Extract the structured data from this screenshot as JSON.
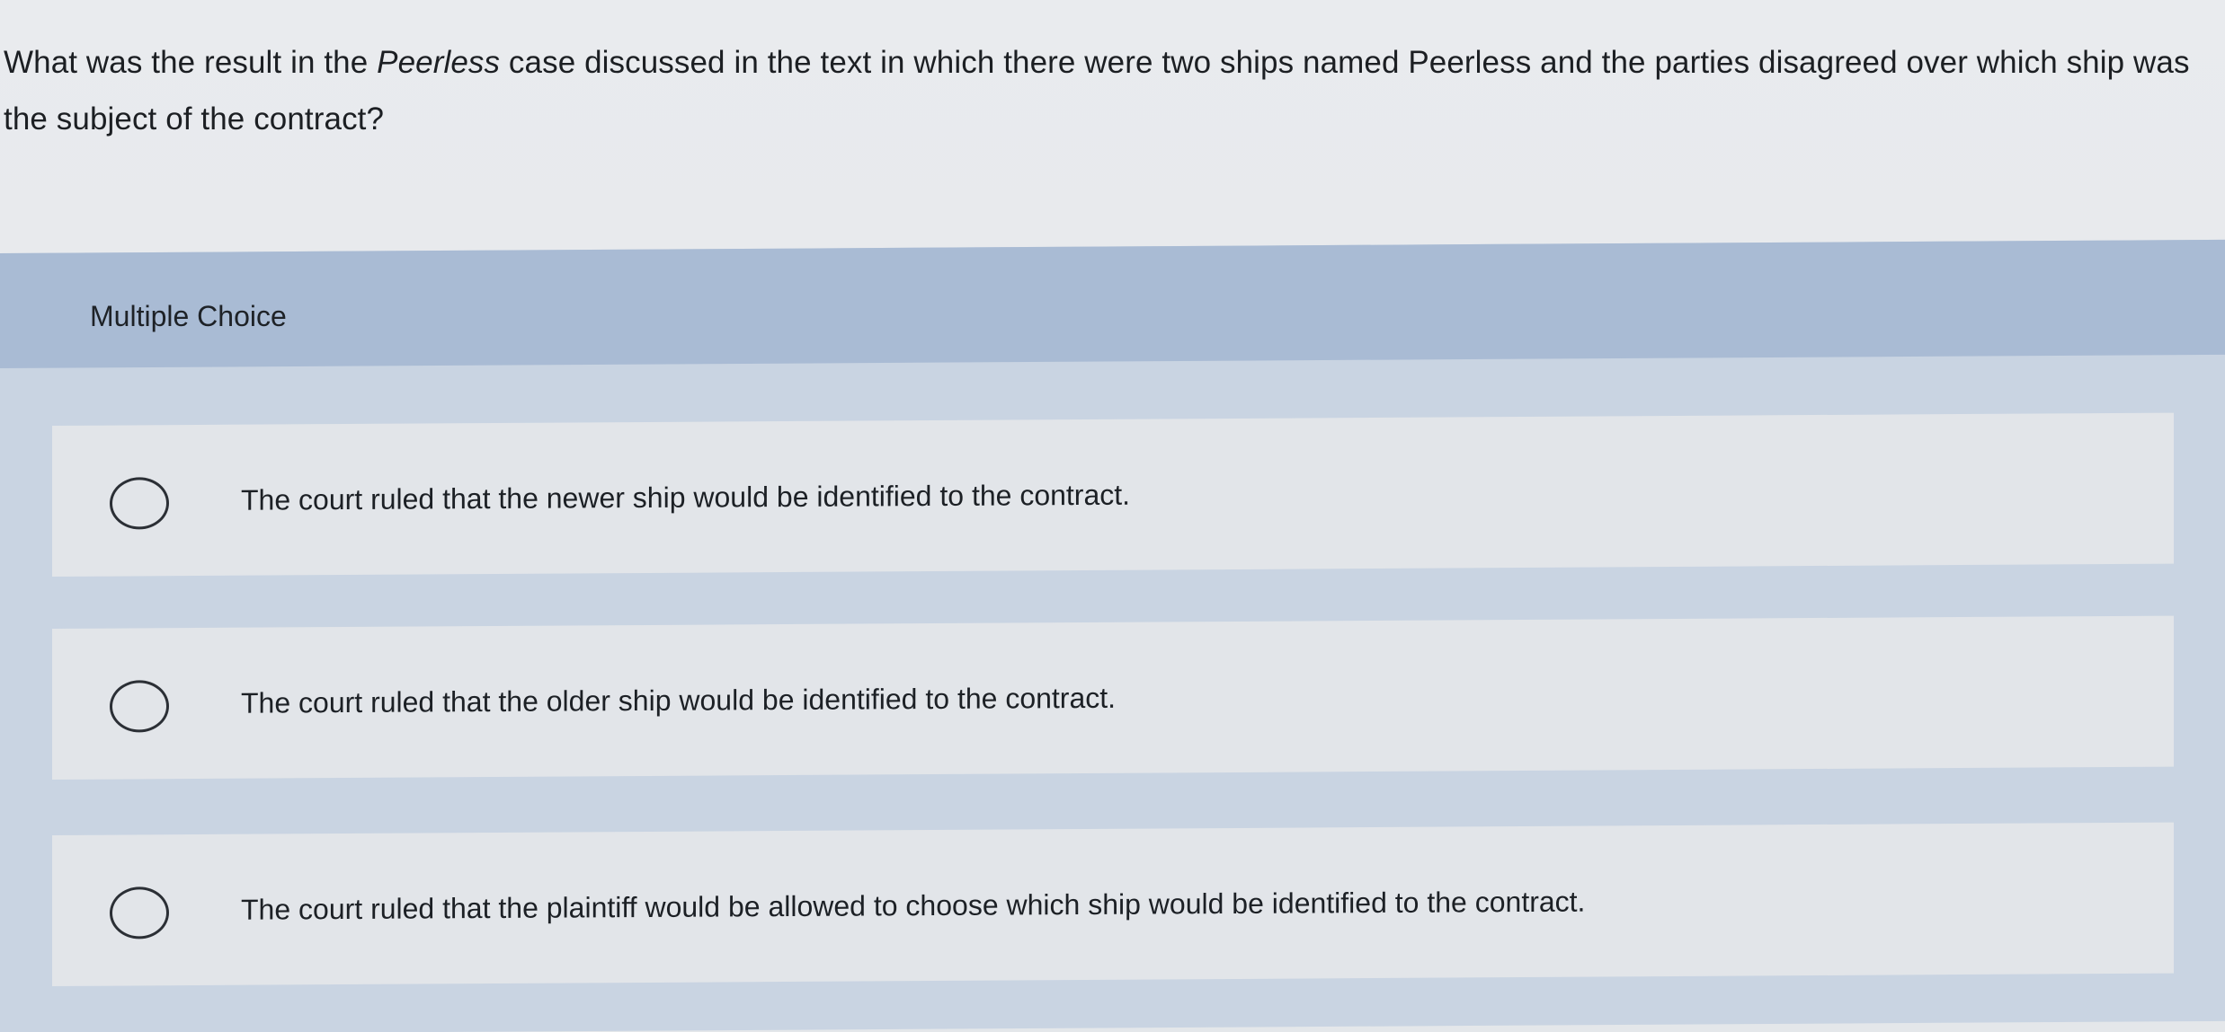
{
  "question": {
    "prefix": "What was the result in the ",
    "italic": "Peerless",
    "suffix": " case discussed in the text in which there were two ships named Peerless and the parties disagreed over which ship was the subject of the contract?"
  },
  "section_label": "Multiple Choice",
  "options": [
    {
      "label": "The court ruled that the newer ship would be identified to the contract."
    },
    {
      "label": "The court ruled that the older ship would be identified to the contract."
    },
    {
      "label": "The court ruled that the plaintiff would be allowed to choose which ship would be identified to the contract."
    }
  ],
  "colors": {
    "header_band": "#a9bbd4",
    "panel": "#c9d4e2",
    "option_bg": "#e2e5e9",
    "text": "#1c1f23"
  }
}
